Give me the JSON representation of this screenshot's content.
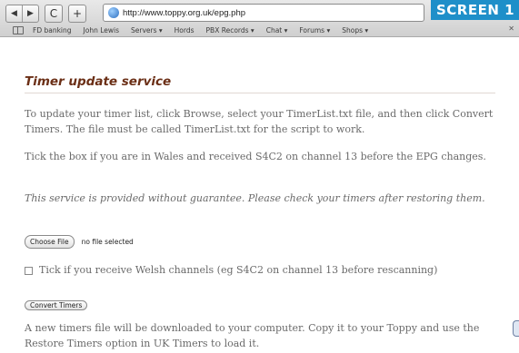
{
  "browser": {
    "nav_back": "◀",
    "nav_forward": "▶",
    "reload": "C",
    "add": "+",
    "url": "http://www.toppy.org.uk/epg.php",
    "badge": "SCREEN 1"
  },
  "bookmarks": [
    "FD banking",
    "John Lewis",
    "Servers ▾",
    "Hords",
    "PBX Records ▾",
    "Chat ▾",
    "Forums ▾",
    "Shops ▾"
  ],
  "page": {
    "title": "Timer update service",
    "intro": "To update your timer list, click Browse, select your TimerList.txt file, and then click Convert Timers. The file must be called TimerList.txt for the script to work.",
    "wales": "Tick the box if you are in Wales and received S4C2 on channel 13 before the EPG changes.",
    "disclaimer": "This service is provided without guarantee. Please check your timers after restoring them.",
    "choose_file": "Choose File",
    "no_file": "no file selected",
    "welsh_checkbox_label": "Tick if you receive Welsh channels (eg S4C2 on channel 13 before rescanning)",
    "convert_timers": "Convert Timers",
    "result": "A new timers file will be downloaded to your computer. Copy it to your Toppy and use the Restore Timers option in UK Timers to load it."
  }
}
